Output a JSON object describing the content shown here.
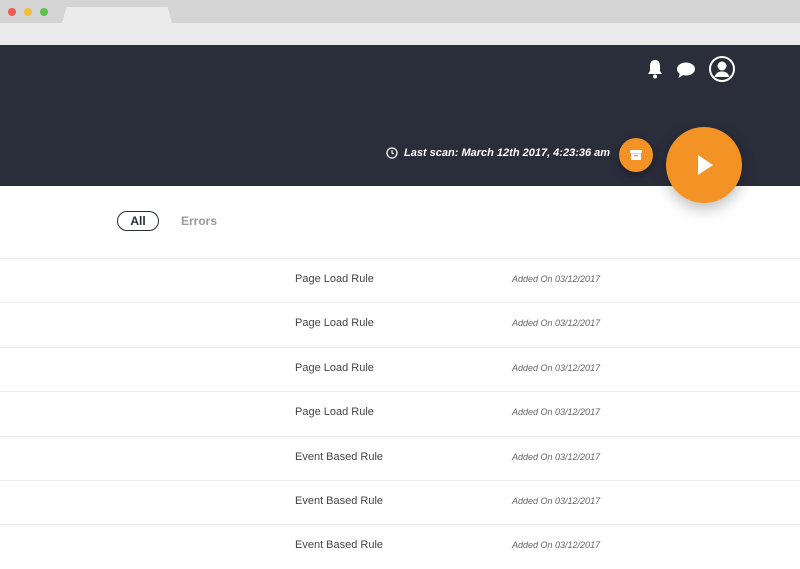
{
  "header": {
    "last_scan": "Last scan: March 12th 2017, 4:23:36 am",
    "icons": [
      "bell-icon",
      "chat-icon",
      "user-avatar-icon",
      "archive-icon",
      "play-icon",
      "clock-icon"
    ],
    "accent_color": "#f39325",
    "header_color": "#2a2d3a"
  },
  "filters": {
    "all_label": "All",
    "errors_label": "Errors"
  },
  "rules": [
    {
      "name": "Page Load Rule",
      "added": "Added On 03/12/2017"
    },
    {
      "name": "Page Load Rule",
      "added": "Added On 03/12/2017"
    },
    {
      "name": "Page Load Rule",
      "added": "Added On 03/12/2017"
    },
    {
      "name": "Page Load Rule",
      "added": "Added On 03/12/2017"
    },
    {
      "name": "Event Based Rule",
      "added": "Added On 03/12/2017"
    },
    {
      "name": "Event Based Rule",
      "added": "Added On 03/12/2017"
    },
    {
      "name": "Event Based Rule",
      "added": "Added On 03/12/2017"
    }
  ]
}
